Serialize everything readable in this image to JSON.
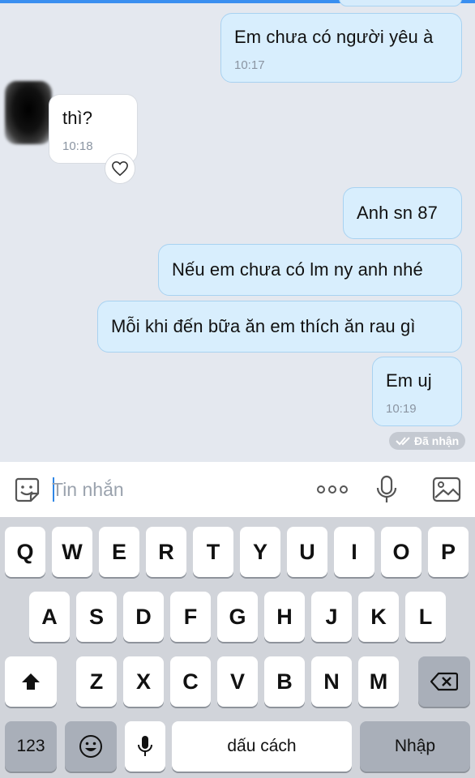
{
  "messages": [
    {
      "side": "me",
      "text": "Em chưa có người yêu à",
      "time": "10:17"
    },
    {
      "side": "them",
      "text": "thì?",
      "time": "10:18"
    },
    {
      "side": "me",
      "text": "Anh sn 87"
    },
    {
      "side": "me",
      "text": "Nếu em chưa có lm ny anh nhé"
    },
    {
      "side": "me",
      "text": "Mỗi khi đến bữa ăn em thích ăn rau gì"
    },
    {
      "side": "me",
      "text": "Em uj",
      "time": "10:19"
    }
  ],
  "status": {
    "label": "Đã nhận"
  },
  "composer": {
    "placeholder": "Tin nhắn"
  },
  "keyboard": {
    "row1": [
      "Q",
      "W",
      "E",
      "R",
      "T",
      "Y",
      "U",
      "I",
      "O",
      "P"
    ],
    "row2": [
      "A",
      "S",
      "D",
      "F",
      "G",
      "H",
      "J",
      "K",
      "L"
    ],
    "row3": [
      "Z",
      "X",
      "C",
      "V",
      "B",
      "N",
      "M"
    ],
    "numbers_label": "123",
    "space_label": "dấu cách",
    "enter_label": "Nhập"
  },
  "colors": {
    "outgoing_bubble": "#d8eefd",
    "incoming_bubble": "#ffffff",
    "accent": "#2f86e6",
    "chat_background": "#e4e8ef"
  },
  "icons": [
    "sticker-icon",
    "more-icon",
    "microphone-icon",
    "image-icon",
    "heart-icon",
    "double-check-icon",
    "shift-icon",
    "backspace-icon",
    "emoji-icon",
    "dictation-icon"
  ]
}
